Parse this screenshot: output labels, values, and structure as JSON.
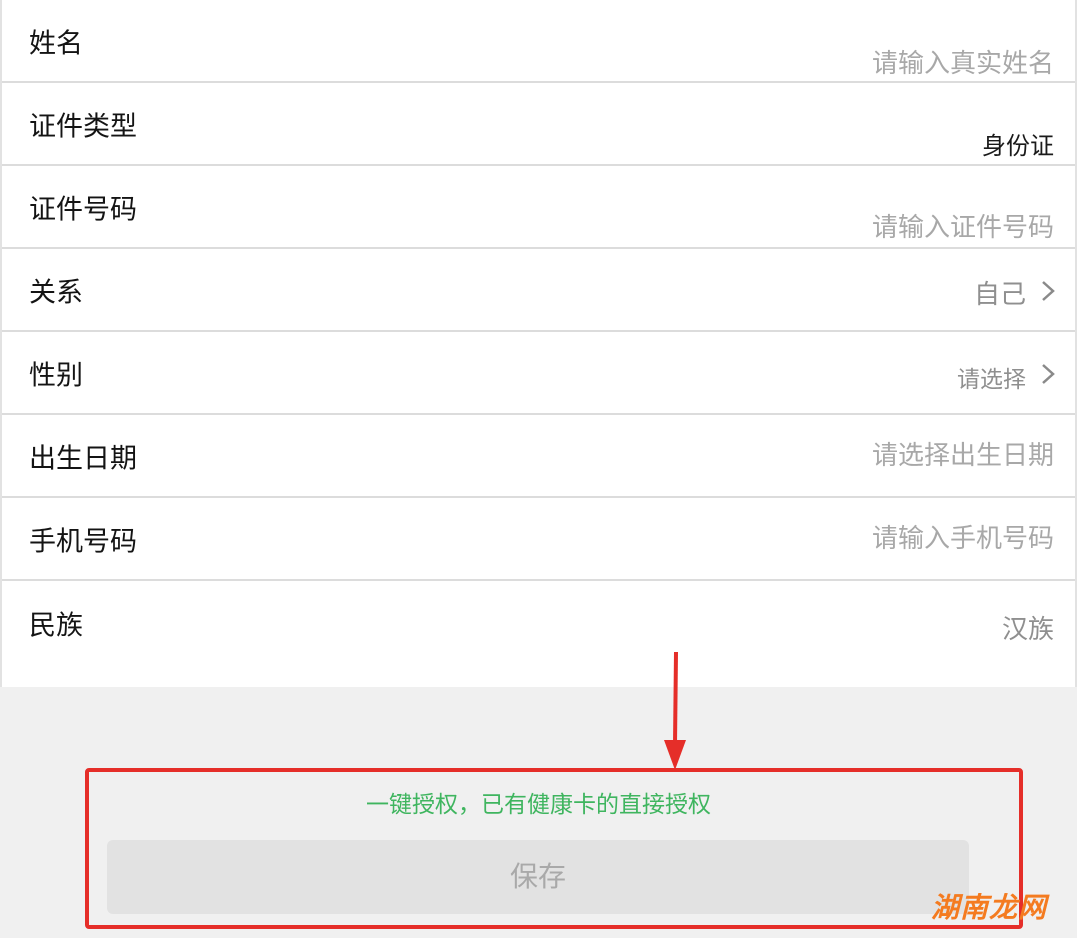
{
  "form": {
    "rows": [
      {
        "label": "姓名",
        "value": "请输入真实姓名"
      },
      {
        "label": "证件类型",
        "value": "身份证"
      },
      {
        "label": "证件号码",
        "value": "请输入证件号码"
      },
      {
        "label": "关系",
        "value": "自己"
      },
      {
        "label": "性别",
        "value": "请选择"
      },
      {
        "label": "出生日期",
        "value": "请选择出生日期"
      },
      {
        "label": "手机号码",
        "value": "请输入手机号码"
      },
      {
        "label": "民族",
        "value": "汉族"
      }
    ]
  },
  "auth": {
    "link_text": "一键授权，已有健康卡的直接授权"
  },
  "actions": {
    "save_label": "保存"
  },
  "watermark": {
    "text": "湖南龙网"
  },
  "colors": {
    "accent_green": "#3fb55f",
    "annotation_red": "#e52e29",
    "watermark_orange": "#f47b20"
  },
  "icons": {
    "row_arrow": "chevron-right-icon",
    "annotation_arrow": "down-arrow-icon"
  }
}
